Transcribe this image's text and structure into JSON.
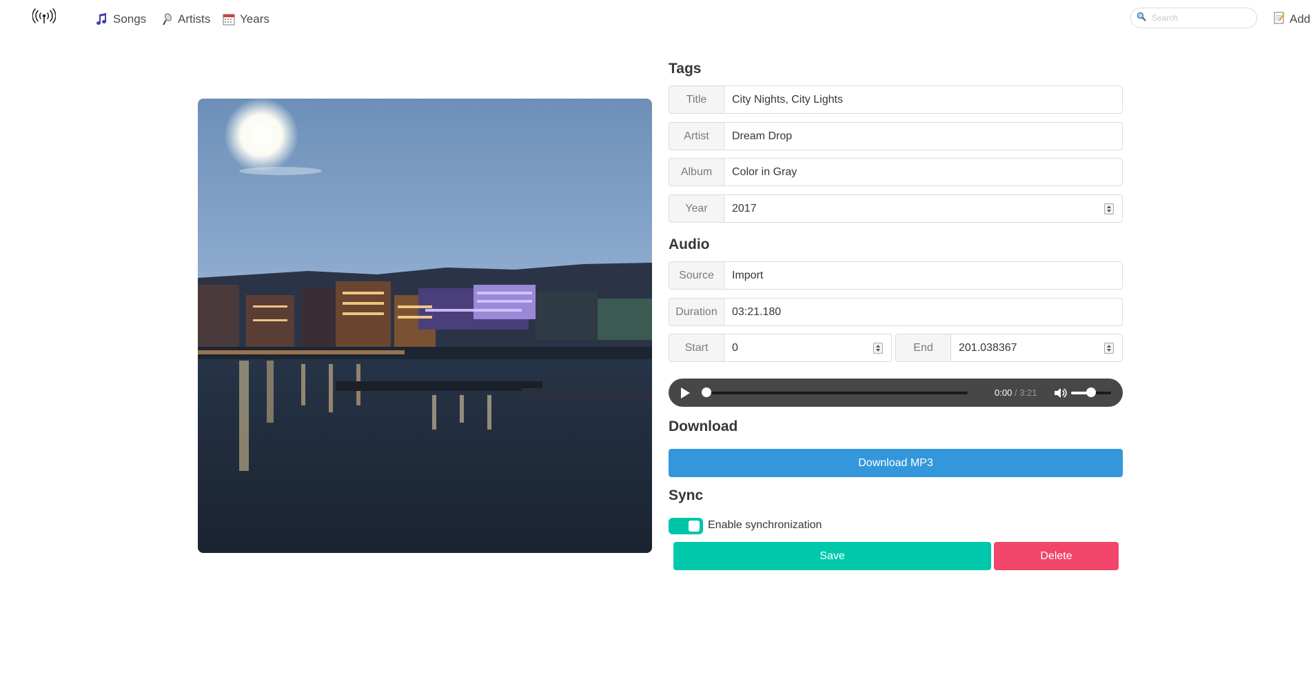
{
  "nav": {
    "songs": "Songs",
    "artists": "Artists",
    "years": "Years",
    "search_placeholder": "Search",
    "add": "Add"
  },
  "icons": {
    "logo": "broadcast-icon",
    "songs": "music-note-icon",
    "artists": "microphone-icon",
    "years": "calendar-icon",
    "search": "magnifier-icon",
    "add": "memo-icon"
  },
  "cover": {
    "description_name": "album-cover-image"
  },
  "tags": {
    "heading": "Tags",
    "title_label": "Title",
    "title_value": "City Nights, City Lights",
    "artist_label": "Artist",
    "artist_value": "Dream Drop",
    "album_label": "Album",
    "album_value": "Color in Gray",
    "year_label": "Year",
    "year_value": "2017"
  },
  "audio": {
    "heading": "Audio",
    "source_label": "Source",
    "source_value": "Import",
    "duration_label": "Duration",
    "duration_value": "03:21.180",
    "start_label": "Start",
    "start_value": "0",
    "end_label": "End",
    "end_value": "201.038367",
    "player": {
      "current_time": "0:00",
      "separator": " / ",
      "total_time": "3:21",
      "progress_fraction": 0,
      "volume_fraction": 0.5
    }
  },
  "download": {
    "heading": "Download",
    "button_label": "Download MP3"
  },
  "sync": {
    "heading": "Sync",
    "toggle_label": "Enable synchronization",
    "enabled": true
  },
  "actions": {
    "save_label": "Save",
    "delete_label": "Delete"
  },
  "colors": {
    "download": "#3497dc",
    "save": "#00c9ab",
    "delete": "#f1456a",
    "toggle": "#00c4a7",
    "player": "#474747"
  }
}
